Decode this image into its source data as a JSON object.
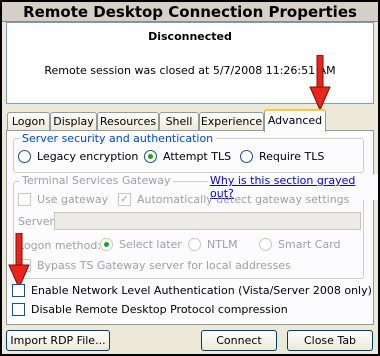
{
  "window": {
    "title": "Remote Desktop Connection Properties"
  },
  "status": {
    "title": "Disconnected",
    "message": "Remote session was closed at 5/7/2008 11:26:51 AM"
  },
  "tabs": [
    {
      "label": "Logon"
    },
    {
      "label": "Display"
    },
    {
      "label": "Resources"
    },
    {
      "label": "Shell"
    },
    {
      "label": "Experience"
    },
    {
      "label": "Advanced"
    }
  ],
  "advanced": {
    "security_group_label": "Server security and authentication",
    "security_options": [
      {
        "label": "Legacy encryption",
        "selected": false
      },
      {
        "label": "Attempt TLS",
        "selected": true
      },
      {
        "label": "Require TLS",
        "selected": false
      }
    ],
    "gateway_group_label": "Terminal Services Gateway",
    "gateway_link": "Why is this section grayed out?",
    "use_gateway_label": "Use gateway",
    "auto_detect_label": "Automatically detect gateway settings",
    "server_label": "Server:",
    "logon_method_label": "Logon method:",
    "logon_methods": [
      {
        "label": "Select later",
        "selected": true
      },
      {
        "label": "NTLM",
        "selected": false
      },
      {
        "label": "Smart Card",
        "selected": false
      }
    ],
    "bypass_label": "Bypass TS Gateway server for local addresses",
    "nla_label": "Enable Network Level Authentication (Vista/Server 2008 only)",
    "disable_compression_label": "Disable Remote Desktop Protocol compression"
  },
  "buttons": {
    "import": "Import RDP File...",
    "connect": "Connect",
    "close_tab": "Close Tab"
  },
  "colors": {
    "arrow": "#e8251a",
    "link": "#0000ee",
    "group_label": "#0046d5"
  },
  "icons": [
    "red-arrow-icon",
    "radio-icon",
    "checkbox-icon"
  ]
}
